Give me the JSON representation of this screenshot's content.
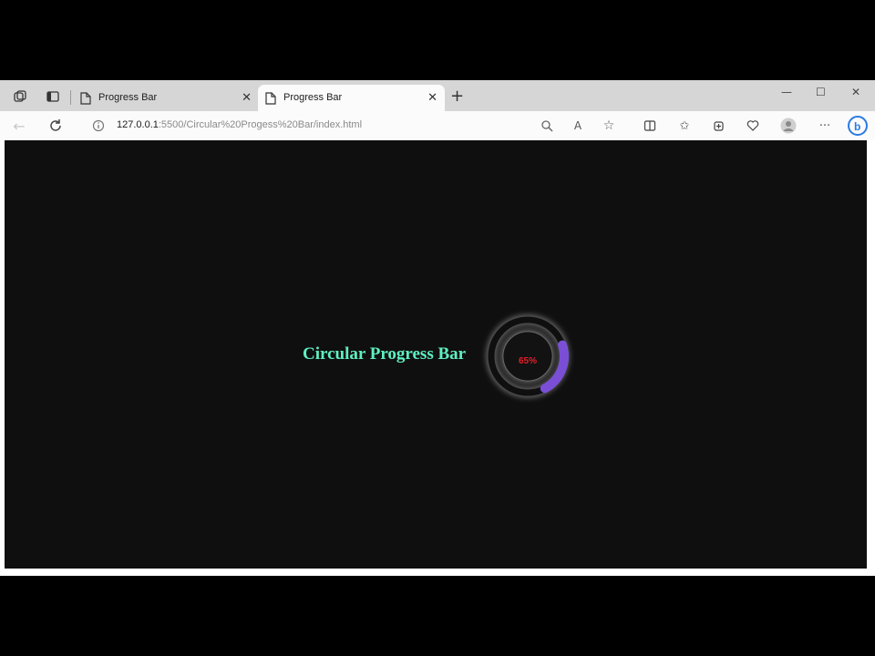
{
  "browser": {
    "tabs": [
      {
        "title": "Progress Bar",
        "active": false
      },
      {
        "title": "Progress Bar",
        "active": true
      }
    ],
    "address": {
      "host": "127.0.0.1",
      "path": ":5500/Circular%20Progess%20Bar/index.html"
    },
    "icons": [
      "workspaces-icon",
      "tab-actions-icon",
      "page-icon",
      "close-icon",
      "new-tab-icon",
      "minimize-icon",
      "maximize-icon",
      "window-close-icon",
      "back-icon",
      "refresh-icon",
      "info-icon",
      "zoom-icon",
      "read-aloud-icon",
      "favorite-icon",
      "split-screen-icon",
      "favorites-icon",
      "collections-icon",
      "browser-essentials-icon",
      "profile-icon",
      "more-icon",
      "bing-icon"
    ]
  },
  "page": {
    "heading": "Circular Progress Bar",
    "progress_text": "65%",
    "progress_value": 0.65,
    "colors": {
      "background": "#0f0f10",
      "heading": "#5ff0c0",
      "percent": "#e0202a",
      "arc": "#7a4fd6"
    }
  }
}
